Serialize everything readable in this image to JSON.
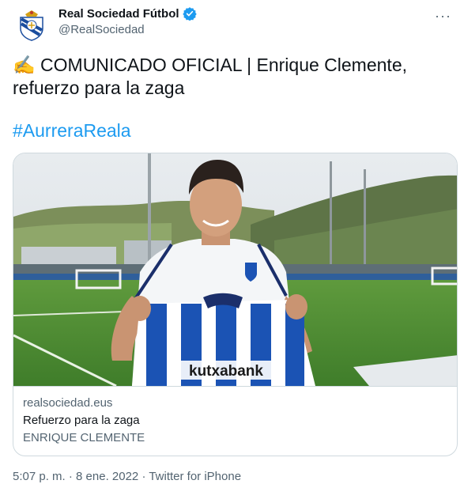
{
  "tweet": {
    "author": {
      "display_name": "Real Sociedad Fútbol",
      "handle": "@RealSociedad",
      "verified": true,
      "avatar_icon": "club-crest-icon"
    },
    "text_emoji": "✍️",
    "text": "COMUNICADO OFICIAL | Enrique Clemente, refuerzo para la zaga",
    "hashtag": "#AurreraReala",
    "card": {
      "domain": "realsociedad.eus",
      "title": "Refuerzo para la zaga",
      "description": "ENRIQUE CLEMENTE",
      "jersey_sponsor": "kutxabank"
    },
    "timestamp": "5:07 p. m. · 8 ene. 2022 · Twitter for iPhone"
  },
  "colors": {
    "link_blue": "#1d9bf0",
    "secondary_text": "#536471",
    "border": "#cfd9de"
  }
}
